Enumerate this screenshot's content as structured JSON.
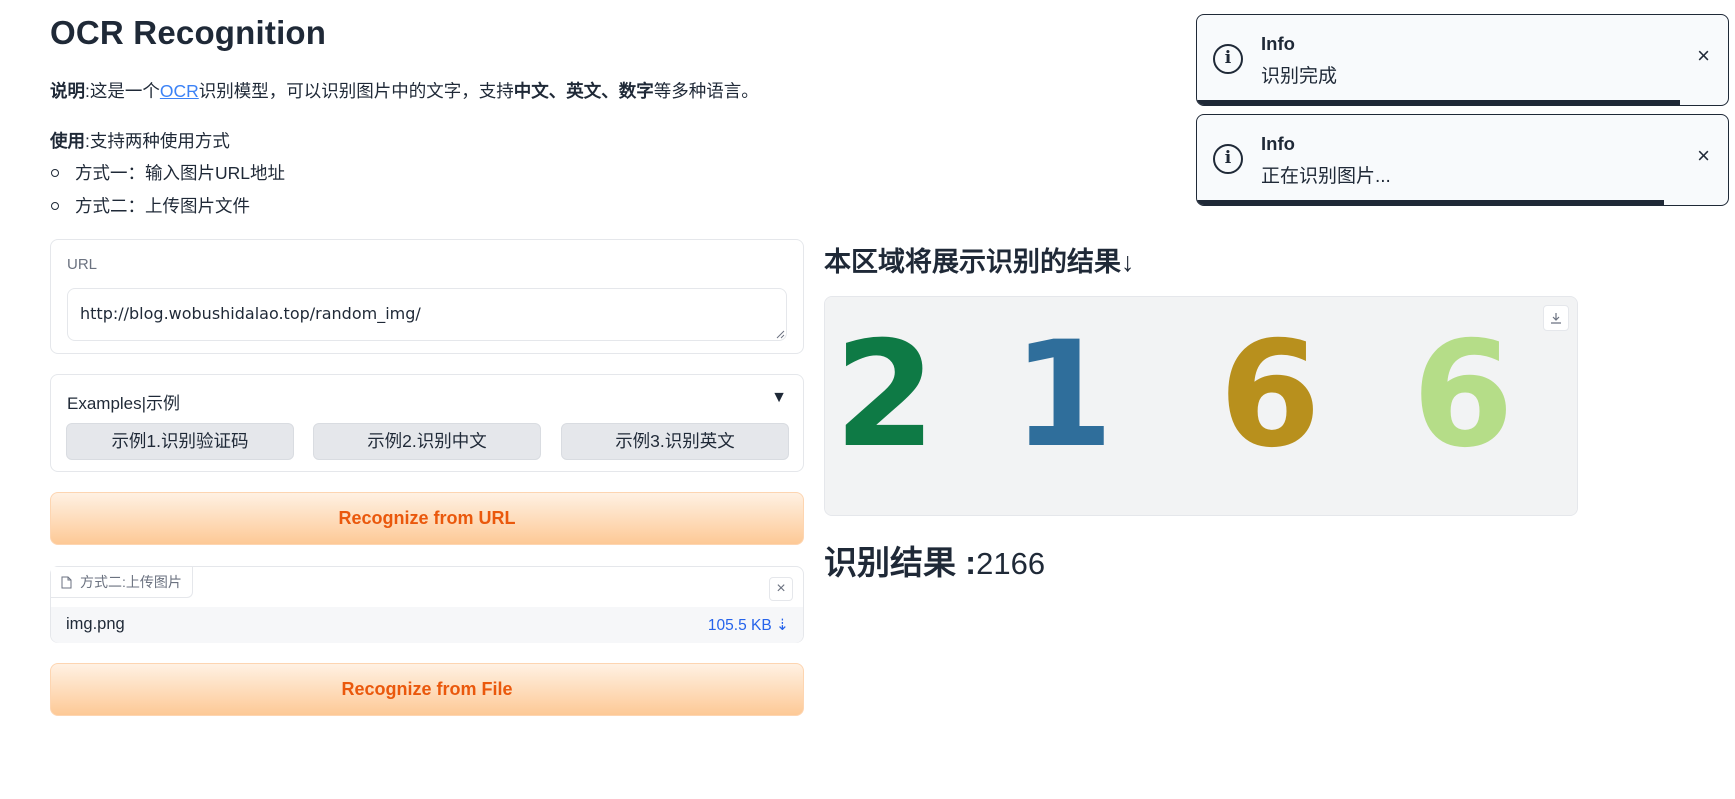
{
  "page_title": "OCR Recognition",
  "description": {
    "label": "说明",
    "t1": ":这是一个",
    "link": "OCR",
    "t2": "识别模型，可以识别图片中的文字，支持",
    "bold_langs": "中文、英文、数字",
    "t3": "等多种语言。"
  },
  "usage": {
    "label": "使用",
    "text": ":支持两种使用方式",
    "methods": [
      "方式一：输入图片URL地址",
      "方式二：上传图片文件"
    ]
  },
  "url_panel": {
    "label": "URL",
    "value": "http://blog.wobushidalao.top/random_img/"
  },
  "examples": {
    "label": "Examples|示例",
    "toggle": "▼",
    "buttons": [
      "示例1.识别验证码",
      "示例2.识别中文",
      "示例3.识别英文"
    ]
  },
  "buttons": {
    "recognize_url": "Recognize from URL",
    "recognize_file": "Recognize from File"
  },
  "file_panel": {
    "tag_label": "方式二:上传图片",
    "clear": "×",
    "file_name": "img.png",
    "file_size": "105.5 KB ⇣"
  },
  "result": {
    "heading": "本区域将展示识别的结果↓",
    "captcha_digits": [
      "2",
      "1",
      "6",
      "6"
    ],
    "captcha_colors": [
      "#0e7a45",
      "#2f6e9b",
      "#b8901d",
      "#b5dd88"
    ],
    "label": "识别结果 :",
    "value": "2166"
  },
  "toasts": [
    {
      "title": "Info",
      "message": "识别完成",
      "close": "×",
      "progress": 0.91
    },
    {
      "title": "Info",
      "message": "正在识别图片...",
      "close": "×",
      "progress": 0.88
    }
  ]
}
